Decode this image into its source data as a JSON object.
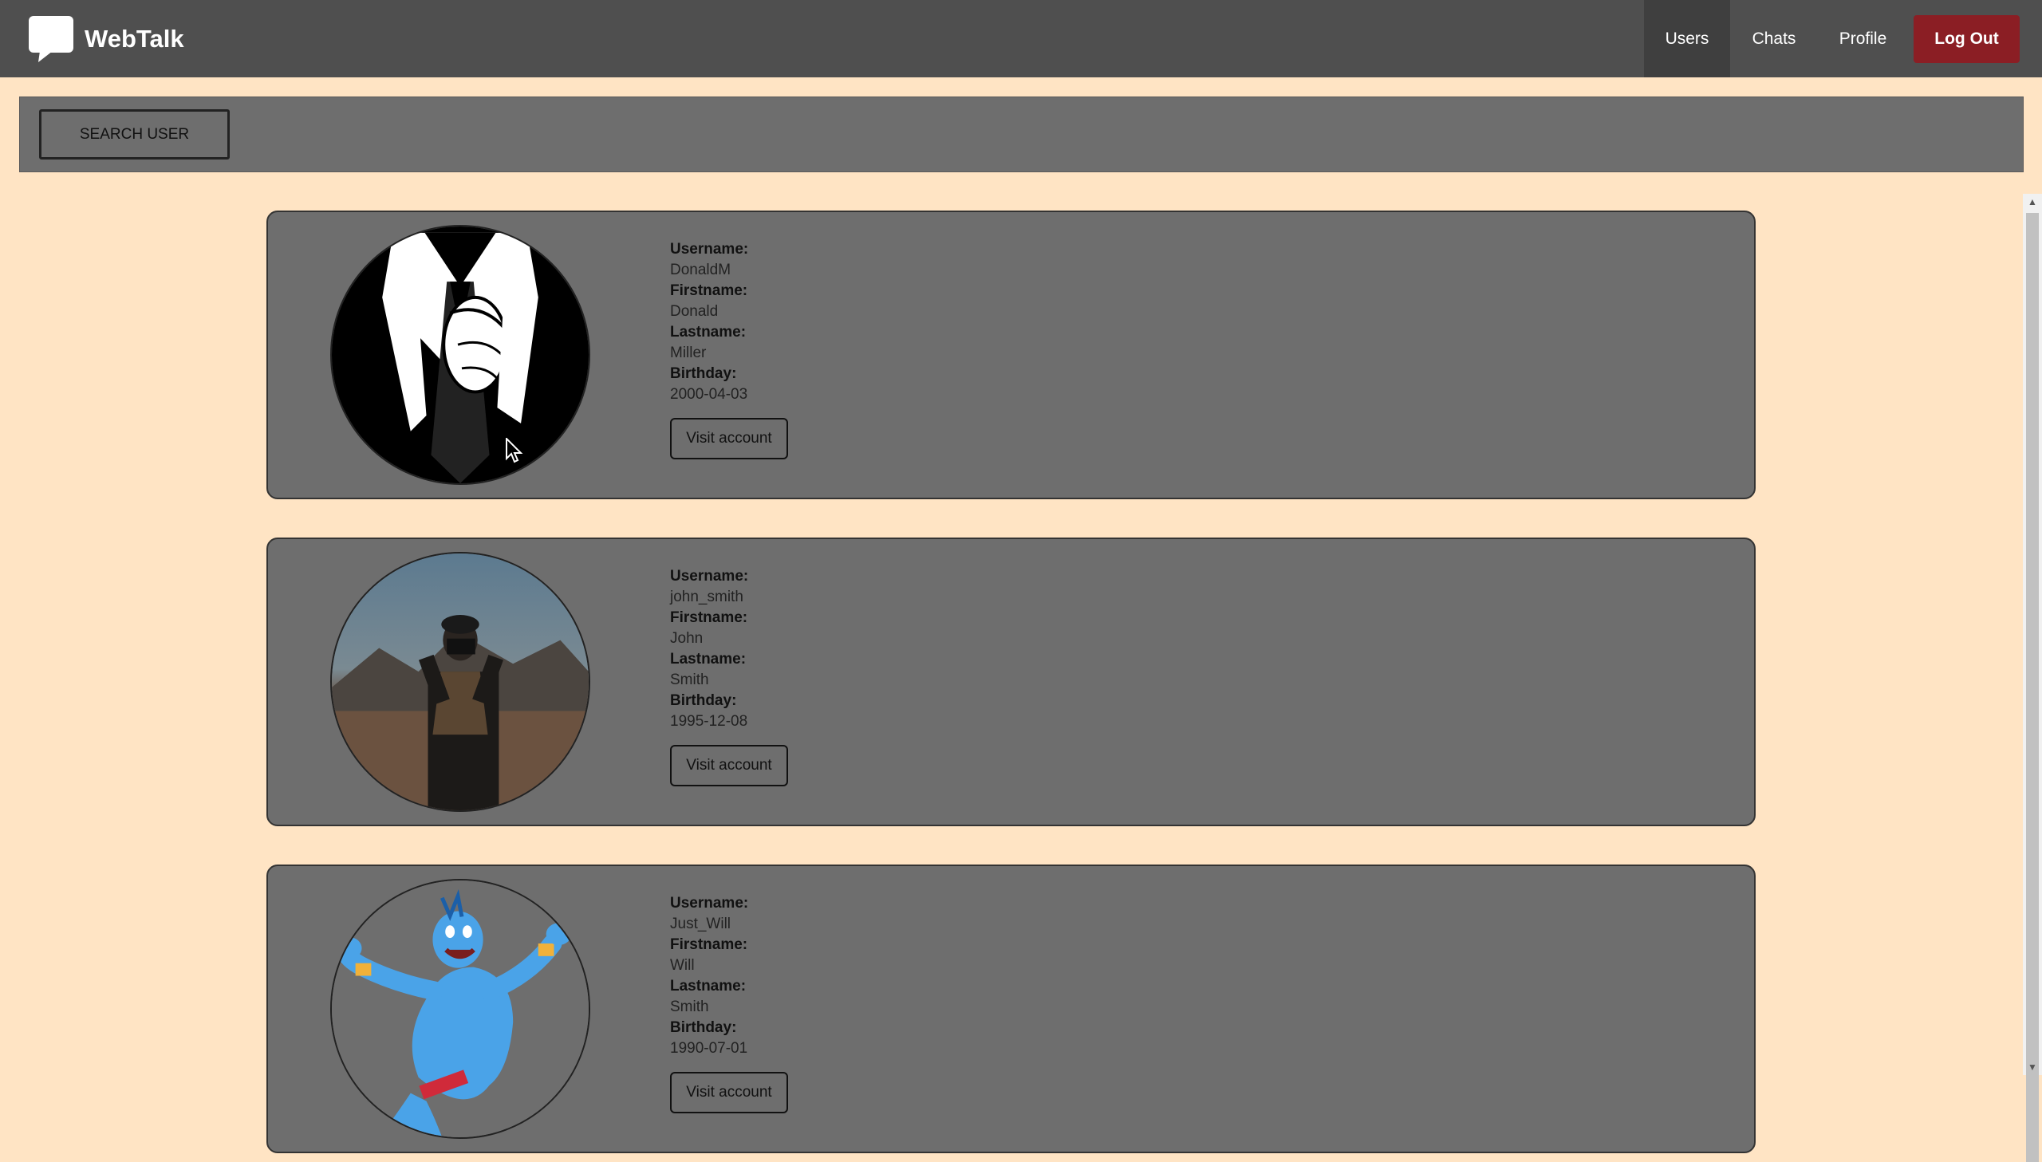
{
  "app": {
    "brand": "WebTalk"
  },
  "nav": {
    "users": "Users",
    "chats": "Chats",
    "profile": "Profile",
    "logout": "Log Out"
  },
  "search": {
    "button_label": "SEARCH USER"
  },
  "labels": {
    "username": "Username:",
    "firstname": "Firstname:",
    "lastname": "Lastname:",
    "birthday": "Birthday:",
    "visit": "Visit account"
  },
  "users": [
    {
      "username": "DonaldM",
      "firstname": "Donald",
      "lastname": "Miller",
      "birthday": "2000-04-03",
      "avatar": "suit-tie-avatar"
    },
    {
      "username": "john_smith",
      "firstname": "John",
      "lastname": "Smith",
      "birthday": "1995-12-08",
      "avatar": "photographer-avatar"
    },
    {
      "username": "Just_Will",
      "firstname": "Will",
      "lastname": "Smith",
      "birthday": "1990-07-01",
      "avatar": "genie-avatar"
    }
  ],
  "colors": {
    "page_bg": "#ffe4c4",
    "navbar": "#4f4f4f",
    "active_nav": "#3f3f3f",
    "logout": "#8b1e24",
    "card": "#6e6e6e"
  }
}
